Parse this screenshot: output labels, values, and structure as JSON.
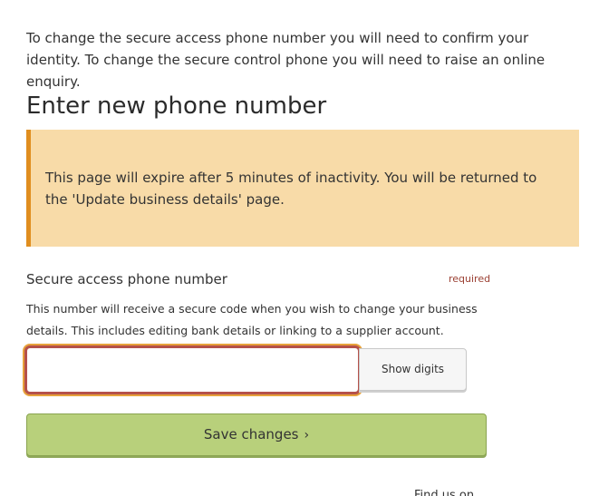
{
  "intro": {
    "text": "To change the secure access phone number you will need to confirm your identity. To change the secure control phone you will need to raise an online enquiry."
  },
  "page": {
    "heading": "Enter new phone number"
  },
  "notice": {
    "text": "This page will expire after 5 minutes of inactivity. You will be returned to the 'Update business details' page."
  },
  "form": {
    "phone_label": "Secure access phone number",
    "required_label": "required",
    "hint": "This number will receive a secure code when you wish to change your business details. This includes editing bank details or linking to a supplier account.",
    "phone_value": "",
    "show_digits_label": "Show digits",
    "save_label": "Save changes",
    "save_chevron": "›"
  },
  "footer": {
    "partial_text": "Find us on"
  },
  "colors": {
    "notice_bg": "#f8dba8",
    "notice_border": "#e08e1f",
    "input_border": "#b5514a",
    "focus_ring": "#e7a23b",
    "save_bg": "#b8d07b",
    "required_text": "#9b4033"
  }
}
